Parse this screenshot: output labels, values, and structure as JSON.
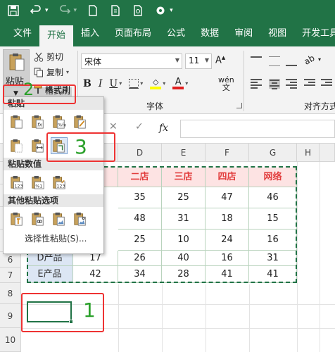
{
  "qat": {
    "icons": [
      "save-icon",
      "undo-icon",
      "redo-icon",
      "new-file-icon",
      "open-file-icon",
      "print-preview-icon",
      "settings-icon"
    ]
  },
  "tabs": [
    "文件",
    "开始",
    "插入",
    "页面布局",
    "公式",
    "数据",
    "审阅",
    "视图",
    "开发工具"
  ],
  "active_tab": "开始",
  "ribbon": {
    "paste_label": "粘贴",
    "cut_label": "剪切",
    "copy_label": "复制",
    "format_painter_label": "格式刷",
    "font_name": "宋体",
    "font_size": "11",
    "font_group_label": "字体",
    "align_group_label": "对齐方式",
    "wen_label": "wén\n文"
  },
  "formula_bar": {
    "fx_label": "fx",
    "cancel": "✕",
    "confirm": "✓",
    "dots": "⋮"
  },
  "columns": [
    "D",
    "E",
    "F",
    "G",
    "H"
  ],
  "rows": [
    "6",
    "7",
    "8",
    "9",
    "10"
  ],
  "table": {
    "headers": [
      "二店",
      "三店",
      "四店",
      "网络"
    ],
    "rows": [
      {
        "product": "",
        "values": [
          "35",
          "25",
          "47",
          "46"
        ]
      },
      {
        "product": "",
        "values": [
          "48",
          "31",
          "18",
          "15"
        ]
      },
      {
        "product": "",
        "values": [
          "25",
          "10",
          "24",
          "16"
        ]
      },
      {
        "product": "D产品",
        "values": [
          "26",
          "40",
          "16",
          "31"
        ]
      },
      {
        "product": "E产品",
        "values": [
          "34",
          "28",
          "41",
          "41"
        ]
      }
    ],
    "partial_b_values": [
      "17",
      "42"
    ]
  },
  "paste_menu": {
    "section_paste": "粘贴",
    "section_values": "粘贴数值",
    "section_other": "其他粘贴选项",
    "paste_special": "选择性粘贴(S)...",
    "row1_icons": [
      "paste-icon",
      "paste-formulas-icon",
      "paste-formulas-number-format-icon",
      "keep-source-formatting-icon"
    ],
    "row2_icons": [
      "no-borders-icon",
      "keep-column-widths-icon",
      "transpose-icon"
    ],
    "values_icons": [
      "paste-values-icon",
      "values-number-format-icon",
      "values-source-formatting-icon"
    ],
    "other_icons": [
      "formatting-icon",
      "paste-link-icon",
      "picture-icon",
      "linked-picture-icon"
    ]
  },
  "annotations": {
    "step1": "1",
    "step2": "2",
    "step3": "3"
  },
  "colors": {
    "excel_green": "#217346",
    "header_red": "#e23c3c",
    "header_bg": "#fde3e3",
    "product_bg": "#dce6f4",
    "annotation_red": "#e33333",
    "annotation_green": "#2aa02a"
  }
}
